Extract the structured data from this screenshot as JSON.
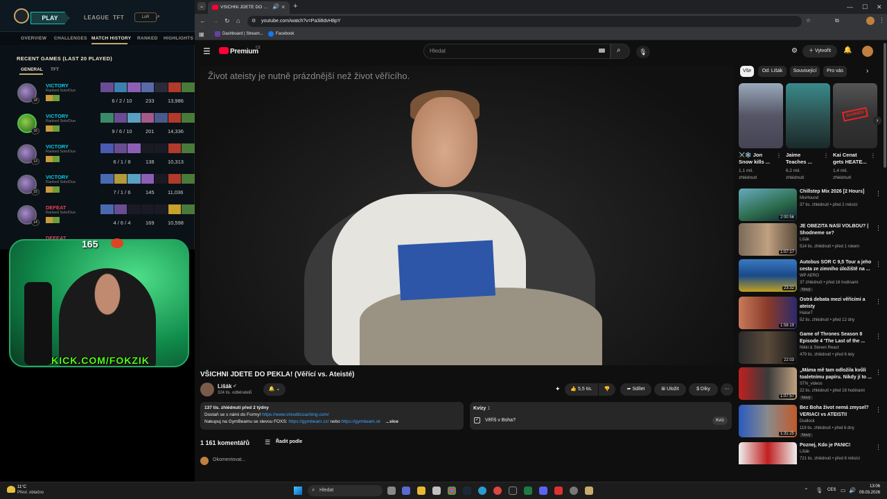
{
  "lol": {
    "play": "PLAY",
    "league": "LEAGUE",
    "tft": "TFT",
    "level_badge": "LoR",
    "nav": [
      "OVERVIEW",
      "CHALLENGES",
      "MATCH HISTORY",
      "RANKED",
      "HIGHLIGHTS"
    ],
    "recent_title": "RECENT GAMES (LAST 20 PLAYED)",
    "sub_tabs": [
      "GENERAL",
      "TFT"
    ],
    "games": [
      {
        "result": "VICTORY",
        "mode": "Ranked Solo/Duo",
        "kda": "6 / 2 / 10",
        "cs": "233",
        "gold": "13,986",
        "level": "18"
      },
      {
        "result": "VICTORY",
        "mode": "Ranked Solo/Duo",
        "kda": "9 / 6 / 10",
        "cs": "201",
        "gold": "14,336",
        "level": "16"
      },
      {
        "result": "VICTORY",
        "mode": "Ranked Solo/Duo",
        "kda": "6 / 1 / 8",
        "cs": "138",
        "gold": "10,313",
        "level": "13"
      },
      {
        "result": "VICTORY",
        "mode": "Ranked Solo/Duo",
        "kda": "7 / 1 / 6",
        "cs": "145",
        "gold": "11,036",
        "level": "15"
      },
      {
        "result": "DEFEAT",
        "mode": "Ranked Solo/Duo",
        "kda": "4 / 6 / 4",
        "cs": "169",
        "gold": "10,598",
        "level": "14"
      },
      {
        "result": "DEFEAT",
        "mode": "",
        "kda": "",
        "cs": "",
        "gold": "",
        "level": ""
      }
    ]
  },
  "cam": {
    "count": "165",
    "kick": "KICK.COM/FOKZIK"
  },
  "browser": {
    "tab_title": "VŠICHNI JDETE DO PEKLA!",
    "url": "youtube.com/watch?v=Pa3i8dvH8pY",
    "bookmarks": [
      "Dashboard | Stream...",
      "Facebook"
    ]
  },
  "yt": {
    "logo": "Premium",
    "logo_sup": "CZ",
    "search_placeholder": "Hledat",
    "create": "Vytvořit",
    "video_quote": "Život ateisty je nutně prázdnější než život věřícího.",
    "title": "VŠICHNI JDETE DO PEKLA! (Věřící vs. Ateisté)",
    "channel": "Lišák",
    "subs": "324 tis. odběratelů",
    "likes": "5,5 tis.",
    "share": "Sdílet",
    "save": "Uložit",
    "thanks": "Díky",
    "desc_meta": "137 tis. zhlédnutí  před 2 týdny",
    "desc_line1": "Dostaň se s námi do Formy!",
    "desc_link1": "https://www.shreditcoaching.com/",
    "desc_line2": "Nakupuj na GymBeamu se slevou FOXS:",
    "desc_link2": "https://gymbeam.cz/",
    "desc_or": "nebo",
    "desc_link3": "https://gymbeam.sk",
    "desc_more": "...více",
    "quiz_title": "Kvízy",
    "quiz_count": "1",
    "quiz_q": "Věříš v Boha?",
    "quiz_btn": "Kvíz",
    "comments_count": "1 161 komentářů",
    "sort": "Řadit podle",
    "comment_placeholder": "Okomentovat...",
    "chips": [
      "Vše",
      "Od: Lišák",
      "Související",
      "Pro vás"
    ],
    "shorts": [
      {
        "title": "⚔️❄️ Jon Snow kills ...",
        "views": "1,1 mil.",
        "views2": "zhlédnutí"
      },
      {
        "title": "Jaime Teaches ...",
        "views": "6,2 mil.",
        "views2": "zhlédnutí"
      },
      {
        "title": "Kai Cenat gets HEATE...",
        "views": "1,4 mil.",
        "views2": "zhlédnutí"
      }
    ],
    "recs": [
      {
        "title": "Chillstep Mix 2026 [2 Hours]",
        "channel": "MixHound",
        "meta": "37 tis. zhlédnutí • před 2 měsíci",
        "dur": "2:00:56",
        "new": ""
      },
      {
        "title": "JE OBEZITA NAŠÍ VOLBOU? | Shodneme se?",
        "channel": "Lišák",
        "meta": "514 tis. zhlédnutí • před 1 rokem",
        "dur": "1:07:17",
        "new": ""
      },
      {
        "title": "Autobus SOR C 9,5 Tour a jeho cesta ze zimního úložiště na ...",
        "channel": "WP AERO",
        "meta": "37 zhlédnutí • před 16 hodinami",
        "dur": "23:32",
        "new": "Nový"
      },
      {
        "title": "Ostrá debata mezi věřícími a ateisty",
        "channel": "HaiseT",
        "meta": "52 tis. zhlédnutí • před 12 dny",
        "dur": "1:58:19",
        "new": ""
      },
      {
        "title": "Game of Thrones Season 8 Episode 4 'The Last of the ...",
        "channel": "Nikki & Steven React",
        "meta": "479 tis. zhlédnutí • před 6 lety",
        "dur": "22:03",
        "new": ""
      },
      {
        "title": "„Máma mě tam odložila kvůli toaletnímu papíru. Nikdy jí to ...",
        "channel": "STN_videos",
        "meta": "22 tis. zhlédnutí • před 18 hodinami",
        "dur": "1:07:57",
        "new": "Nový"
      },
      {
        "title": "Bez Boha život nemá zmysel? VERIACI vs ATEISTI!",
        "channel": "Dudlock",
        "meta": "119 tis. zhlédnutí • před 6 dny",
        "dur": "1:31:25",
        "new": "Nový"
      },
      {
        "title": "Poznej, Kdo je PANIC!",
        "channel": "Lišák",
        "meta": "721 tis. zhlédnutí • před 8 měsíci",
        "dur": "",
        "new": ""
      }
    ]
  },
  "taskbar": {
    "weather_temp": "11°C",
    "weather_desc": "Převl. oblačno",
    "search": "Hledat",
    "lang": "CES",
    "time": "13:06",
    "date": "09.03.2026"
  },
  "colors": {
    "victory": "#0acbe6",
    "defeat": "#e84057",
    "yt_red": "#ff0033"
  }
}
